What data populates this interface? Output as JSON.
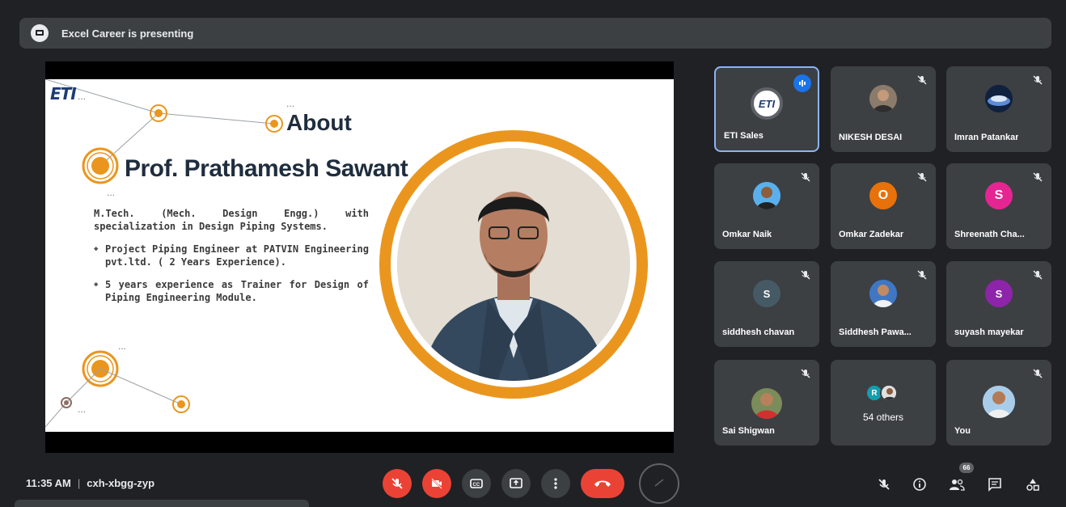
{
  "banner": {
    "text": "Excel Career is presenting"
  },
  "slide": {
    "logo": "ETI",
    "heading": "About",
    "name": "Prof. Prathamesh Sawant",
    "bio": [
      "M.Tech. (Mech. Design Engg.) with specialization in Design Piping Systems.",
      "Project Piping Engineer at PATVIN Engineering pvt.ltd. ( 2 Years Experience).",
      "5 years experience as Trainer for  Design of Piping Engineering Module."
    ]
  },
  "participants": [
    {
      "name": "ETI Sales",
      "avatar": "ETI",
      "avatar_color": "#ffffff",
      "speaking": true,
      "muted": false
    },
    {
      "name": "NIKESH DESAI",
      "avatar": "photo",
      "muted": true
    },
    {
      "name": "Imran Patankar",
      "avatar": "photo",
      "muted": true
    },
    {
      "name": "Omkar Naik",
      "avatar": "photo",
      "muted": true
    },
    {
      "name": "Omkar Zadekar",
      "avatar": "O",
      "avatar_color": "#e8710a",
      "muted": true
    },
    {
      "name": "Shreenath Cha...",
      "avatar": "S",
      "avatar_color": "#e52592",
      "muted": true
    },
    {
      "name": "siddhesh chavan",
      "avatar": "S",
      "avatar_color": "#455a64",
      "muted": true
    },
    {
      "name": "Siddhesh Pawa...",
      "avatar": "photo",
      "muted": true
    },
    {
      "name": "suyash mayekar",
      "avatar": "S",
      "avatar_color": "#8e24aa",
      "muted": true
    },
    {
      "name": "Sai Shigwan",
      "avatar": "photo",
      "muted": true
    },
    {
      "name": "You",
      "avatar": "photo",
      "muted": true
    }
  ],
  "others": {
    "label": "54 others",
    "mini_avatar": "R",
    "mini_color": "#129eaf"
  },
  "meeting": {
    "time": "11:35 AM",
    "separator": "|",
    "code": "cxh-xbgg-zyp"
  },
  "people_count": "66",
  "colors": {
    "accent_red": "#ea4335",
    "tile_bg": "#3c4043",
    "slide_orange": "#ea961e",
    "active_border": "#8ab4f8"
  }
}
